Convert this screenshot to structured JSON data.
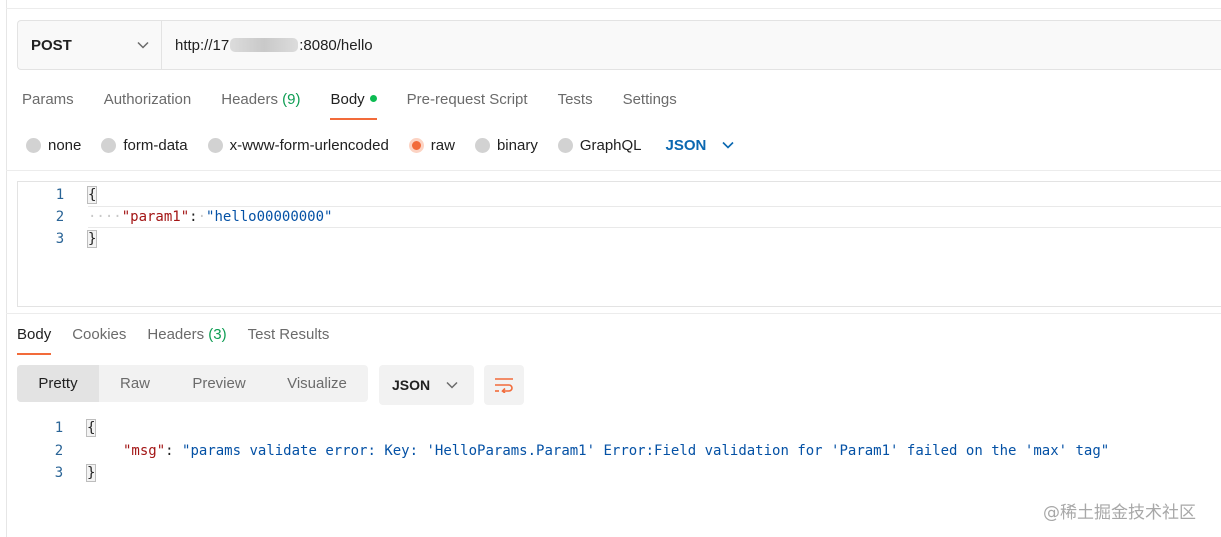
{
  "request": {
    "method": "POST",
    "url_prefix": "http://17",
    "url_suffix": ":8080/hello"
  },
  "request_tabs": [
    {
      "label": "Params"
    },
    {
      "label": "Authorization"
    },
    {
      "label": "Headers",
      "count": "(9)"
    },
    {
      "label": "Body",
      "active": true
    },
    {
      "label": "Pre-request Script"
    },
    {
      "label": "Tests"
    },
    {
      "label": "Settings"
    }
  ],
  "body_types": [
    {
      "label": "none"
    },
    {
      "label": "form-data"
    },
    {
      "label": "x-www-form-urlencoded"
    },
    {
      "label": "raw",
      "checked": true
    },
    {
      "label": "binary"
    },
    {
      "label": "GraphQL"
    }
  ],
  "body_language": "JSON",
  "request_body": {
    "line_numbers": [
      "1",
      "2",
      "3"
    ],
    "open_brace": "{",
    "dots": "····",
    "key": "\"param1\"",
    "colon": ":",
    "value": "\"hello00000000\"",
    "close_brace": "}"
  },
  "response_tabs": [
    {
      "label": "Body",
      "active": true
    },
    {
      "label": "Cookies"
    },
    {
      "label": "Headers",
      "count": "(3)"
    },
    {
      "label": "Test Results"
    }
  ],
  "view_modes": [
    {
      "label": "Pretty",
      "active": true
    },
    {
      "label": "Raw"
    },
    {
      "label": "Preview"
    },
    {
      "label": "Visualize"
    }
  ],
  "response_format": "JSON",
  "response_body": {
    "line_numbers": [
      "1",
      "2",
      "3"
    ],
    "open_brace": "{",
    "key": "\"msg\"",
    "colon": ":",
    "value": "\"params validate error: Key: 'HelloParams.Param1' Error:Field validation for 'Param1' failed on the 'max' tag\"",
    "close_brace": "}"
  },
  "watermark": "@稀土掘金技术社区",
  "colors": {
    "accent": "#f26b3a",
    "count_green": "#0e9d53",
    "json_key": "#a31515",
    "json_string": "#0451a5",
    "link_blue": "#0b68b1"
  },
  "icons": {
    "method_dropdown": "chevron-down-icon",
    "language_dropdown": "chevron-down-icon",
    "format_dropdown": "chevron-down-icon",
    "wrap": "wrap-lines-icon"
  }
}
